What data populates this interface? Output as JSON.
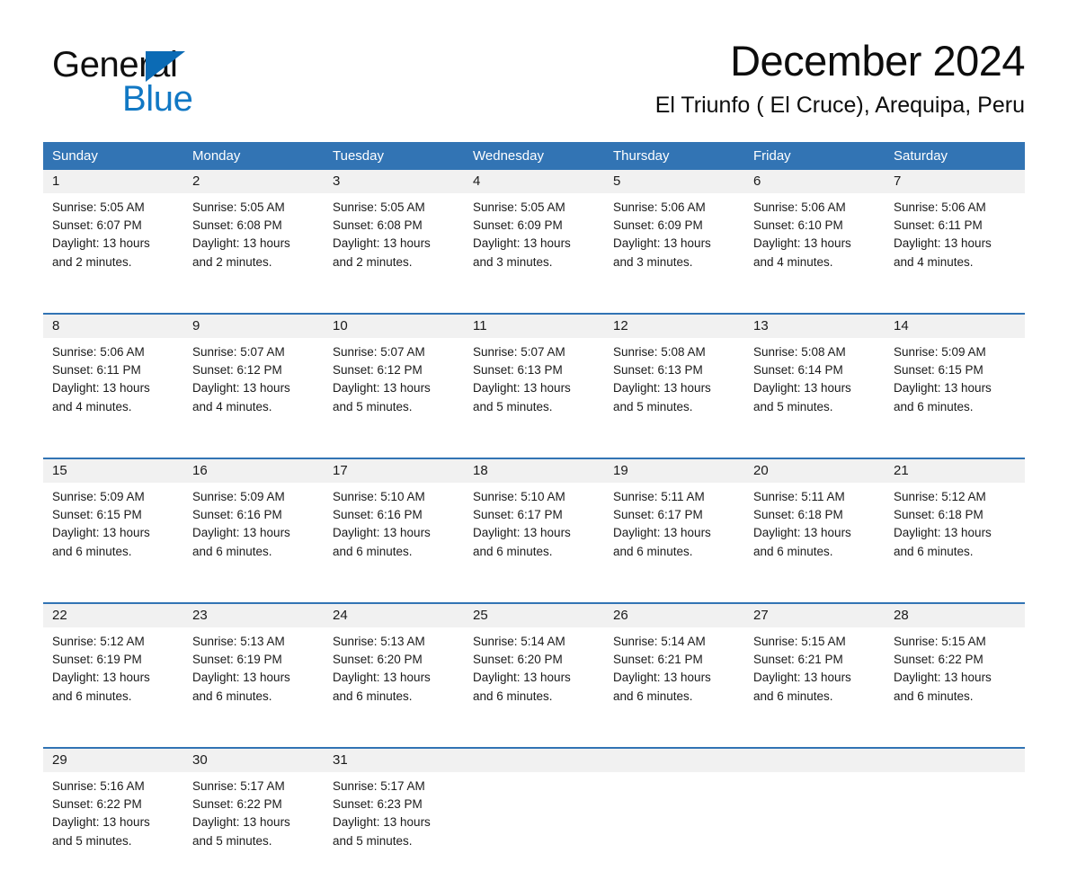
{
  "brand": {
    "line1": "General",
    "line2": "Blue",
    "triangle_color": "#0b6bb5",
    "blue_text_color": "#1178c4"
  },
  "header": {
    "month_title": "December 2024",
    "location": "El Triunfo ( El Cruce), Arequipa, Peru"
  },
  "theme": {
    "header_blue": "#3274b4",
    "daynum_band": "#f1f1f1",
    "text": "#1a1a1a",
    "page_background": "#ffffff"
  },
  "weekdays": [
    "Sunday",
    "Monday",
    "Tuesday",
    "Wednesday",
    "Thursday",
    "Friday",
    "Saturday"
  ],
  "weeks": [
    [
      {
        "day": "1",
        "sunrise": "Sunrise: 5:05 AM",
        "sunset": "Sunset: 6:07 PM",
        "daylight_1": "Daylight: 13 hours",
        "daylight_2": "and 2 minutes."
      },
      {
        "day": "2",
        "sunrise": "Sunrise: 5:05 AM",
        "sunset": "Sunset: 6:08 PM",
        "daylight_1": "Daylight: 13 hours",
        "daylight_2": "and 2 minutes."
      },
      {
        "day": "3",
        "sunrise": "Sunrise: 5:05 AM",
        "sunset": "Sunset: 6:08 PM",
        "daylight_1": "Daylight: 13 hours",
        "daylight_2": "and 2 minutes."
      },
      {
        "day": "4",
        "sunrise": "Sunrise: 5:05 AM",
        "sunset": "Sunset: 6:09 PM",
        "daylight_1": "Daylight: 13 hours",
        "daylight_2": "and 3 minutes."
      },
      {
        "day": "5",
        "sunrise": "Sunrise: 5:06 AM",
        "sunset": "Sunset: 6:09 PM",
        "daylight_1": "Daylight: 13 hours",
        "daylight_2": "and 3 minutes."
      },
      {
        "day": "6",
        "sunrise": "Sunrise: 5:06 AM",
        "sunset": "Sunset: 6:10 PM",
        "daylight_1": "Daylight: 13 hours",
        "daylight_2": "and 4 minutes."
      },
      {
        "day": "7",
        "sunrise": "Sunrise: 5:06 AM",
        "sunset": "Sunset: 6:11 PM",
        "daylight_1": "Daylight: 13 hours",
        "daylight_2": "and 4 minutes."
      }
    ],
    [
      {
        "day": "8",
        "sunrise": "Sunrise: 5:06 AM",
        "sunset": "Sunset: 6:11 PM",
        "daylight_1": "Daylight: 13 hours",
        "daylight_2": "and 4 minutes."
      },
      {
        "day": "9",
        "sunrise": "Sunrise: 5:07 AM",
        "sunset": "Sunset: 6:12 PM",
        "daylight_1": "Daylight: 13 hours",
        "daylight_2": "and 4 minutes."
      },
      {
        "day": "10",
        "sunrise": "Sunrise: 5:07 AM",
        "sunset": "Sunset: 6:12 PM",
        "daylight_1": "Daylight: 13 hours",
        "daylight_2": "and 5 minutes."
      },
      {
        "day": "11",
        "sunrise": "Sunrise: 5:07 AM",
        "sunset": "Sunset: 6:13 PM",
        "daylight_1": "Daylight: 13 hours",
        "daylight_2": "and 5 minutes."
      },
      {
        "day": "12",
        "sunrise": "Sunrise: 5:08 AM",
        "sunset": "Sunset: 6:13 PM",
        "daylight_1": "Daylight: 13 hours",
        "daylight_2": "and 5 minutes."
      },
      {
        "day": "13",
        "sunrise": "Sunrise: 5:08 AM",
        "sunset": "Sunset: 6:14 PM",
        "daylight_1": "Daylight: 13 hours",
        "daylight_2": "and 5 minutes."
      },
      {
        "day": "14",
        "sunrise": "Sunrise: 5:09 AM",
        "sunset": "Sunset: 6:15 PM",
        "daylight_1": "Daylight: 13 hours",
        "daylight_2": "and 6 minutes."
      }
    ],
    [
      {
        "day": "15",
        "sunrise": "Sunrise: 5:09 AM",
        "sunset": "Sunset: 6:15 PM",
        "daylight_1": "Daylight: 13 hours",
        "daylight_2": "and 6 minutes."
      },
      {
        "day": "16",
        "sunrise": "Sunrise: 5:09 AM",
        "sunset": "Sunset: 6:16 PM",
        "daylight_1": "Daylight: 13 hours",
        "daylight_2": "and 6 minutes."
      },
      {
        "day": "17",
        "sunrise": "Sunrise: 5:10 AM",
        "sunset": "Sunset: 6:16 PM",
        "daylight_1": "Daylight: 13 hours",
        "daylight_2": "and 6 minutes."
      },
      {
        "day": "18",
        "sunrise": "Sunrise: 5:10 AM",
        "sunset": "Sunset: 6:17 PM",
        "daylight_1": "Daylight: 13 hours",
        "daylight_2": "and 6 minutes."
      },
      {
        "day": "19",
        "sunrise": "Sunrise: 5:11 AM",
        "sunset": "Sunset: 6:17 PM",
        "daylight_1": "Daylight: 13 hours",
        "daylight_2": "and 6 minutes."
      },
      {
        "day": "20",
        "sunrise": "Sunrise: 5:11 AM",
        "sunset": "Sunset: 6:18 PM",
        "daylight_1": "Daylight: 13 hours",
        "daylight_2": "and 6 minutes."
      },
      {
        "day": "21",
        "sunrise": "Sunrise: 5:12 AM",
        "sunset": "Sunset: 6:18 PM",
        "daylight_1": "Daylight: 13 hours",
        "daylight_2": "and 6 minutes."
      }
    ],
    [
      {
        "day": "22",
        "sunrise": "Sunrise: 5:12 AM",
        "sunset": "Sunset: 6:19 PM",
        "daylight_1": "Daylight: 13 hours",
        "daylight_2": "and 6 minutes."
      },
      {
        "day": "23",
        "sunrise": "Sunrise: 5:13 AM",
        "sunset": "Sunset: 6:19 PM",
        "daylight_1": "Daylight: 13 hours",
        "daylight_2": "and 6 minutes."
      },
      {
        "day": "24",
        "sunrise": "Sunrise: 5:13 AM",
        "sunset": "Sunset: 6:20 PM",
        "daylight_1": "Daylight: 13 hours",
        "daylight_2": "and 6 minutes."
      },
      {
        "day": "25",
        "sunrise": "Sunrise: 5:14 AM",
        "sunset": "Sunset: 6:20 PM",
        "daylight_1": "Daylight: 13 hours",
        "daylight_2": "and 6 minutes."
      },
      {
        "day": "26",
        "sunrise": "Sunrise: 5:14 AM",
        "sunset": "Sunset: 6:21 PM",
        "daylight_1": "Daylight: 13 hours",
        "daylight_2": "and 6 minutes."
      },
      {
        "day": "27",
        "sunrise": "Sunrise: 5:15 AM",
        "sunset": "Sunset: 6:21 PM",
        "daylight_1": "Daylight: 13 hours",
        "daylight_2": "and 6 minutes."
      },
      {
        "day": "28",
        "sunrise": "Sunrise: 5:15 AM",
        "sunset": "Sunset: 6:22 PM",
        "daylight_1": "Daylight: 13 hours",
        "daylight_2": "and 6 minutes."
      }
    ],
    [
      {
        "day": "29",
        "sunrise": "Sunrise: 5:16 AM",
        "sunset": "Sunset: 6:22 PM",
        "daylight_1": "Daylight: 13 hours",
        "daylight_2": "and 5 minutes."
      },
      {
        "day": "30",
        "sunrise": "Sunrise: 5:17 AM",
        "sunset": "Sunset: 6:22 PM",
        "daylight_1": "Daylight: 13 hours",
        "daylight_2": "and 5 minutes."
      },
      {
        "day": "31",
        "sunrise": "Sunrise: 5:17 AM",
        "sunset": "Sunset: 6:23 PM",
        "daylight_1": "Daylight: 13 hours",
        "daylight_2": "and 5 minutes."
      },
      {
        "day": "",
        "sunrise": "",
        "sunset": "",
        "daylight_1": "",
        "daylight_2": ""
      },
      {
        "day": "",
        "sunrise": "",
        "sunset": "",
        "daylight_1": "",
        "daylight_2": ""
      },
      {
        "day": "",
        "sunrise": "",
        "sunset": "",
        "daylight_1": "",
        "daylight_2": ""
      },
      {
        "day": "",
        "sunrise": "",
        "sunset": "",
        "daylight_1": "",
        "daylight_2": ""
      }
    ]
  ]
}
